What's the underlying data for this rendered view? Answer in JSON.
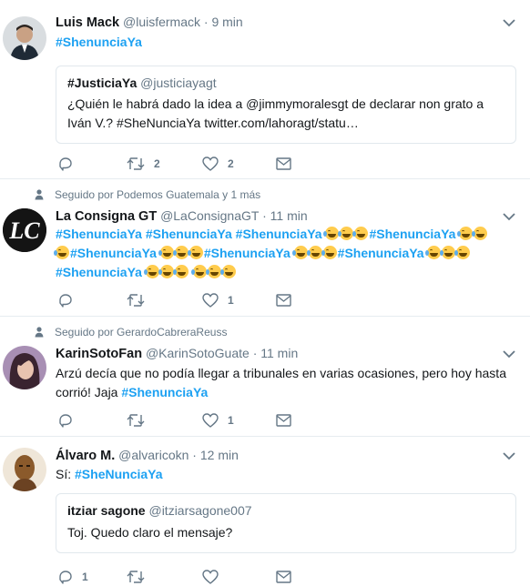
{
  "colors": {
    "accent": "#1da1f2",
    "muted": "#657786",
    "text": "#14171a",
    "border": "#e6ecf0"
  },
  "tweets": [
    {
      "name": "Luis Mack",
      "handle": "@luisfermack",
      "time": "9 min",
      "hashtag": "#ShenunciaYa",
      "quote": {
        "name": "#JusticiaYa",
        "handle": "@justiciayagt",
        "text_line1": "¿Quién le habrá dado la idea a @jimmymoralesgt de declarar non grato a",
        "text_line2": "Iván V.? #SheNunciaYa twitter.com/lahoragt/statu…"
      },
      "retweets": "2",
      "likes": "2"
    },
    {
      "context": "Seguido por Podemos Guatemala y 1 más",
      "name": "La Consigna GT",
      "handle": "@LaConsignaGT",
      "time": "11 min",
      "hashtag": "#ShenunciaYa",
      "likes": "1"
    },
    {
      "context": "Seguido por GerardoCabreraReuss",
      "name": "KarinSotoFan",
      "handle": "@KarinSotoGuate",
      "time": "11 min",
      "text_line1": "Arzú decía que no podía llegar a tribunales en varias ocasiones, pero hoy hasta",
      "text_line2_prefix": "corrió! Jaja",
      "hashtag": "#ShenunciaYa",
      "likes": "1"
    },
    {
      "name": "Álvaro M.",
      "handle": "@alvaricokn",
      "time": "12 min",
      "text_prefix": "Sí:",
      "hashtag": "#SheNunciaYa",
      "quote": {
        "name": "itziar sagone",
        "handle": "@itziarsagone007",
        "text": "Toj. Quedo claro el mensaje?"
      },
      "replies": "1"
    }
  ],
  "icons": [
    "reply-icon",
    "retweet-icon",
    "like-icon",
    "message-icon",
    "chevron-down-icon",
    "person-icon"
  ]
}
